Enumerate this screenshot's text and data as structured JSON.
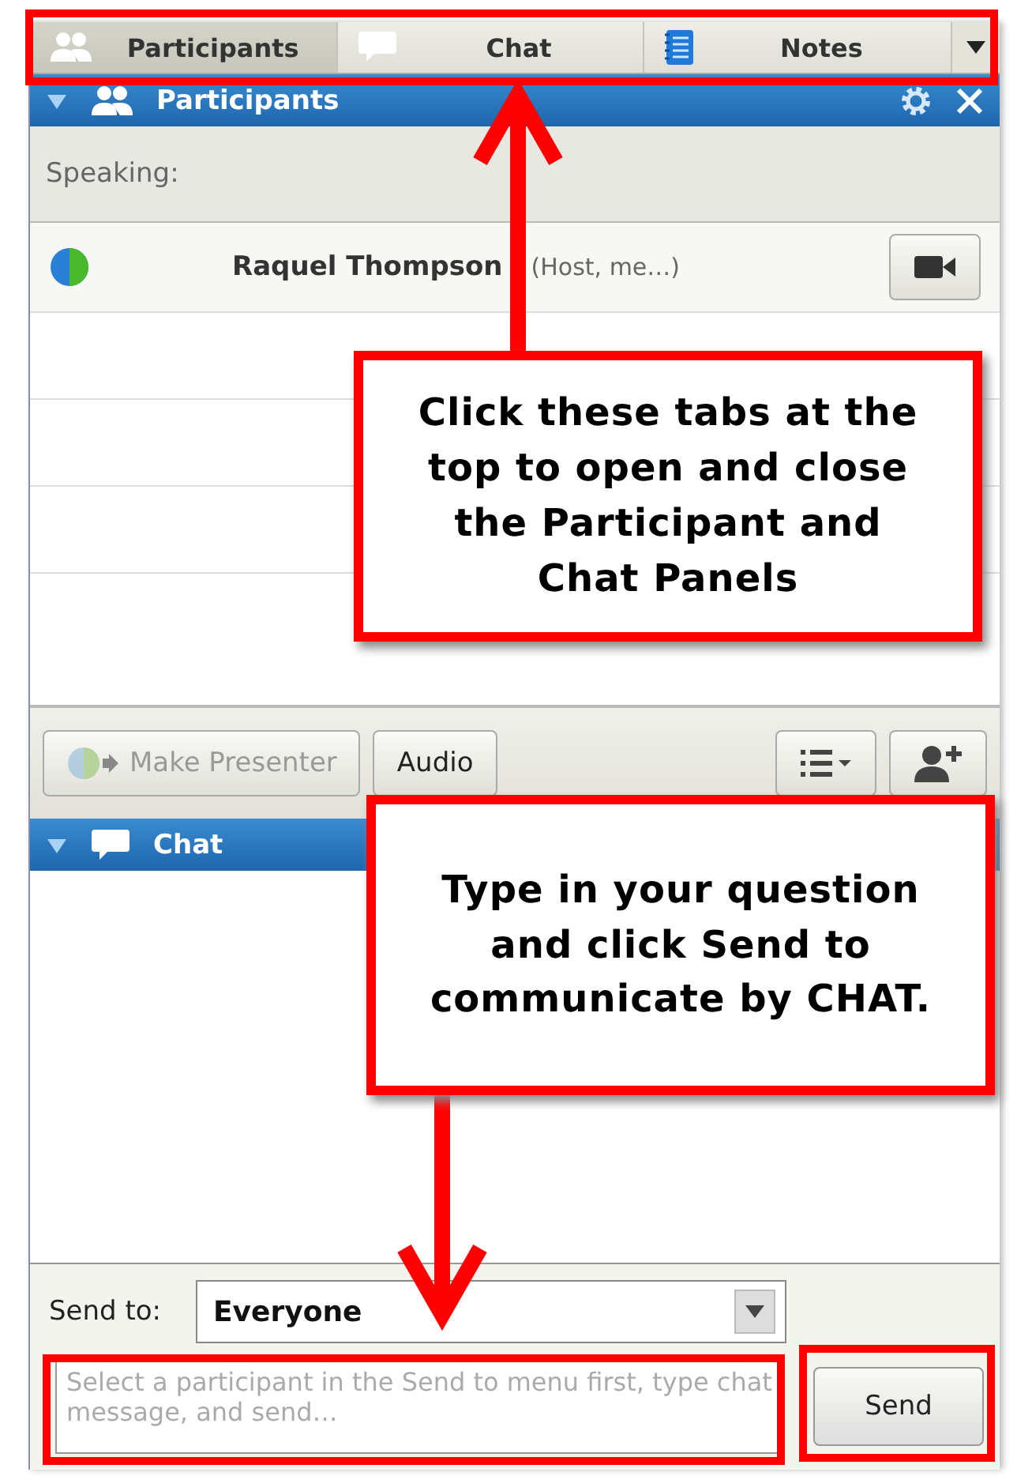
{
  "tabs": [
    {
      "label": "Participants",
      "kind": "people",
      "selected": true
    },
    {
      "label": "Chat",
      "kind": "chat",
      "selected": false
    },
    {
      "label": "Notes",
      "kind": "notes",
      "selected": false
    }
  ],
  "participants_panel": {
    "title": "Participants",
    "expanded": true,
    "speaking_label": "Speaking:",
    "participants": [
      {
        "name": "Raquel Thompson",
        "role": "(Host, me…)"
      }
    ],
    "buttons": [
      {
        "label": "Make Presenter",
        "disabled": true
      },
      {
        "label": "Audio",
        "disabled": false
      }
    ]
  },
  "chat_panel": {
    "title": "Chat",
    "expanded": true,
    "send_to_label": "Send to:",
    "send_to_value": "Everyone",
    "message": {
      "placeholder": "Select a participant in the Send to menu first, type chat message, and send…"
    },
    "send_button": "Send"
  },
  "annotations": [
    {
      "text": "Click these tabs at the top to open and close the Participant and Chat Panels"
    },
    {
      "text": "Type in your question and click Send to communicate by CHAT."
    }
  ]
}
